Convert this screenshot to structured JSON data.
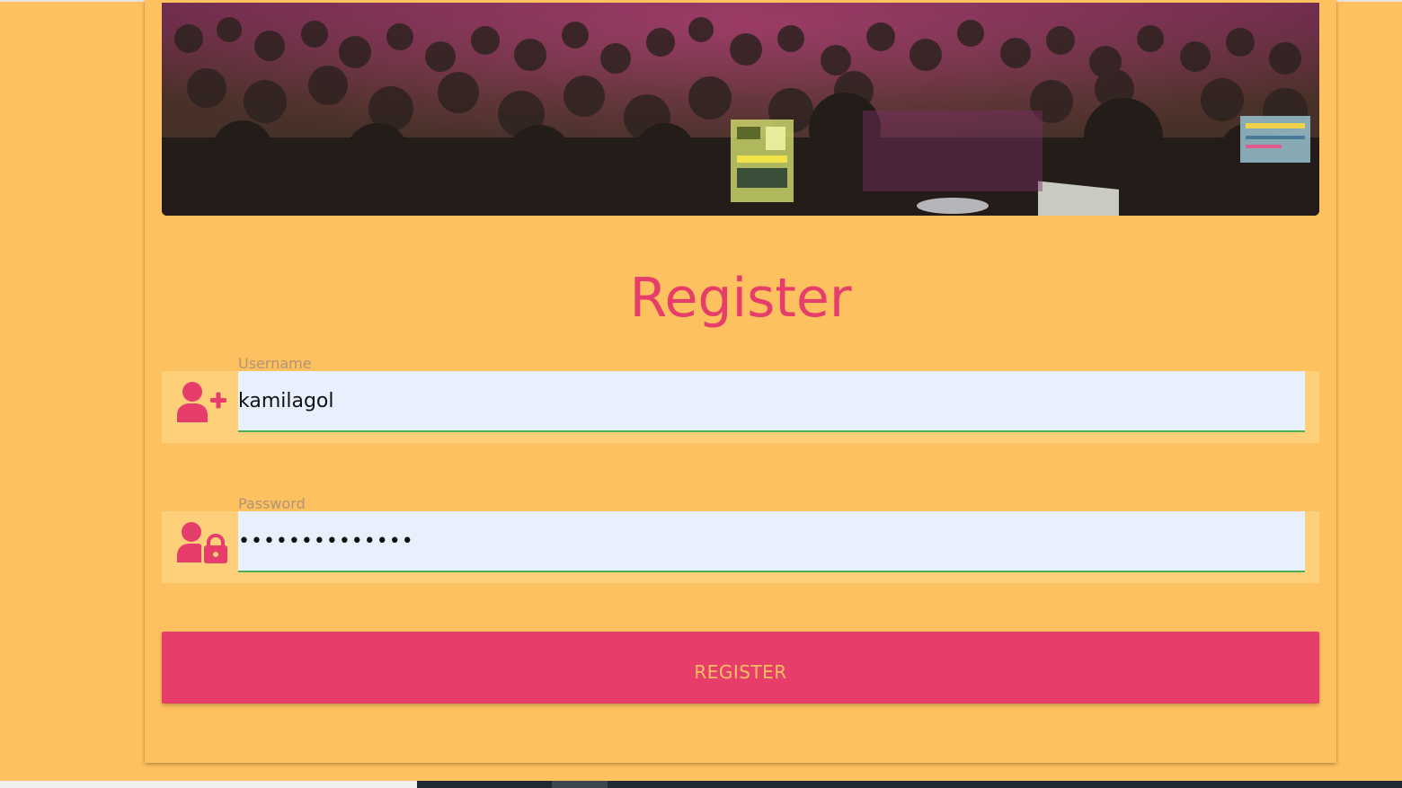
{
  "form": {
    "title": "Register",
    "hero_image": "concert-crowd-photo",
    "username": {
      "label": "Username",
      "value": "kamilagol",
      "icon": "user-plus-icon"
    },
    "password": {
      "label": "Password",
      "value": "••••••••••••••",
      "icon": "user-lock-icon"
    },
    "submit_label": "REGISTER"
  },
  "colors": {
    "background": "#fec15f",
    "accent": "#e63d6b",
    "field_row": "#ffd07a",
    "input_fill": "#e8f0fe",
    "input_underline": "#4caf50"
  }
}
